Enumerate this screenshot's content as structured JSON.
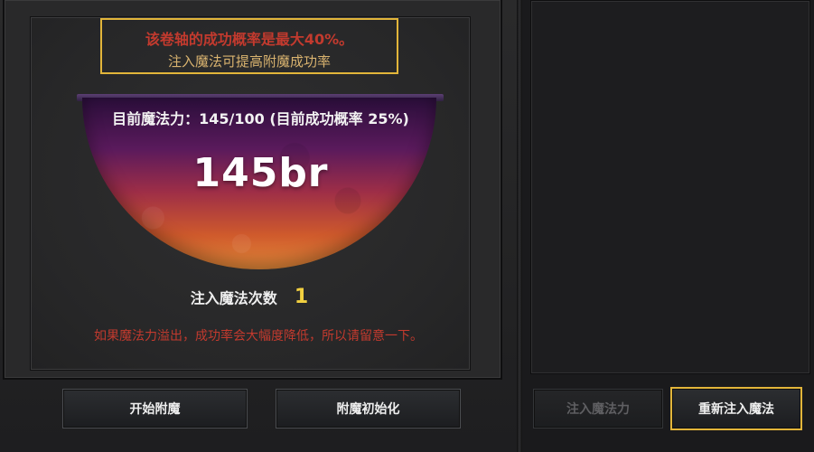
{
  "hint": {
    "line1": "该卷轴的成功概率是最大40%。",
    "line2": "注入魔法可提高附魔成功率"
  },
  "mana": {
    "status_text": "目前魔法力：145/100 (目前成功概率 25%)",
    "big_value": "145br",
    "fill_fraction": 1.0
  },
  "inject_count": {
    "label": "注入魔法次数",
    "value": "1"
  },
  "warning": "如果魔法力溢出，成功率会大幅度降低，所以请留意一下。",
  "buttons": {
    "start_enchant": "开始附魔",
    "reset_enchant": "附魔初始化",
    "inject_mana": "注入魔法力",
    "reinject_mana": "重新注入魔法"
  },
  "colors": {
    "highlight_border": "#e2b53a",
    "warning_red": "#c23a2e",
    "count_yellow": "#f2d040"
  }
}
